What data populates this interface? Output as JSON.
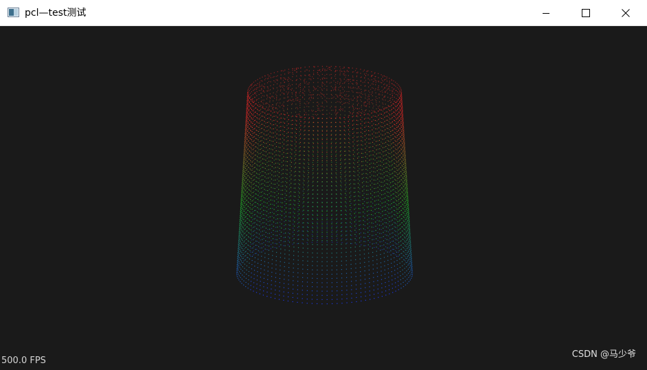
{
  "window": {
    "title": "pcl—test测试",
    "icon": "app-window-icon",
    "controls": [
      "minimize-icon",
      "maximize-icon",
      "close-icon"
    ]
  },
  "viewer": {
    "background": "#1a1a1a",
    "fps_label": "500.0 FPS",
    "watermark": "CSDN @马少爷",
    "cloud_colormap": [
      "#ff2020",
      "#20d020",
      "#2040ff"
    ]
  }
}
